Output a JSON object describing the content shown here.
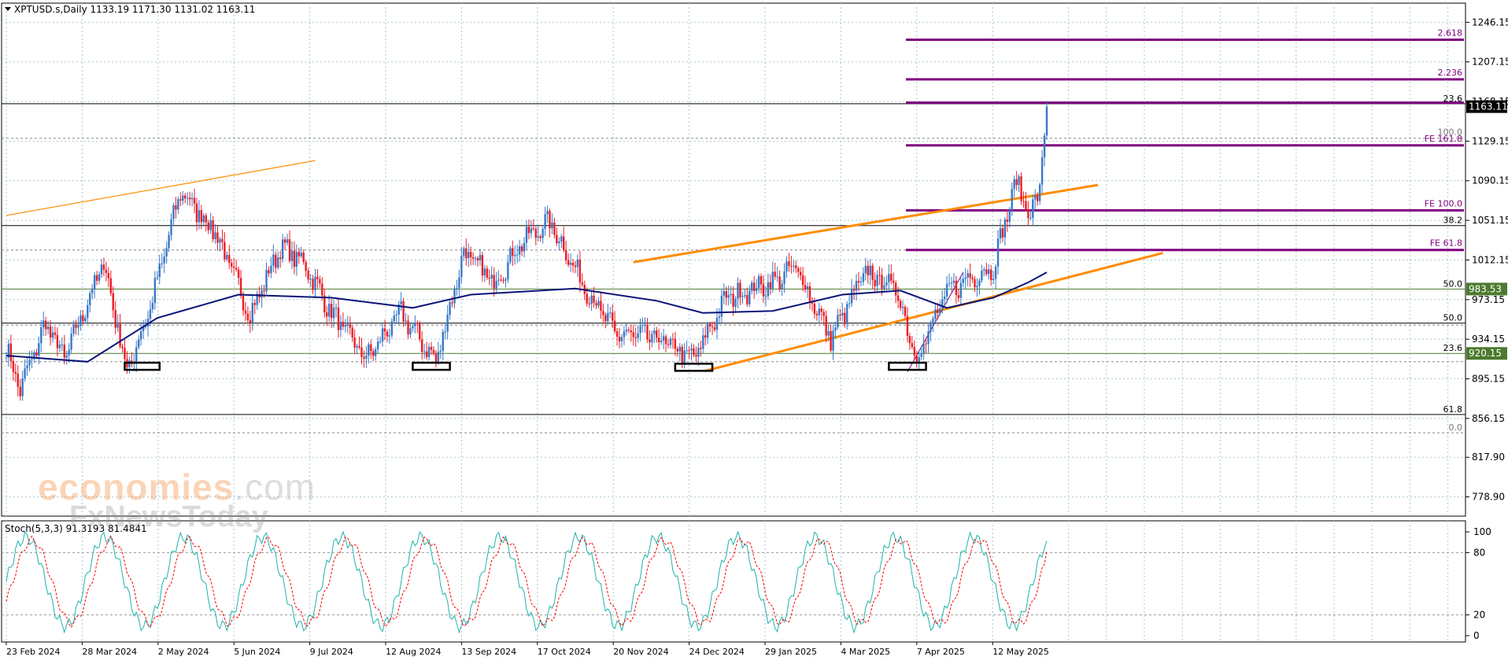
{
  "header": {
    "symbol": "XPTUSD.s,Daily",
    "ohlc": "1133.19 1171.30 1131.02 1163.11",
    "indicator": "Stoch(5,3,3) 91.3193 81.4841"
  },
  "watermark": {
    "brand": "economies",
    "tld": ".com",
    "sub": "FxNewsToday"
  },
  "colors": {
    "bull": "#3778c8",
    "bear": "#ee1c24",
    "ma": "#0a1478",
    "channel": "#ff8c00",
    "fib_ext": "#800080",
    "hline_green": "#4c7a2e",
    "grid": "#aac8d2",
    "stoch_main": "#20b2aa",
    "stoch_signal": "#ff0000"
  },
  "chart_data": [
    {
      "type": "candlestick",
      "title": "XPTUSD.s,Daily",
      "x_tick_labels": [
        "23 Feb 2024",
        "28 Mar 2024",
        "2 May 2024",
        "5 Jun 2024",
        "9 Jul 2024",
        "12 Aug 2024",
        "13 Sep 2024",
        "17 Oct 2024",
        "20 Nov 2024",
        "24 Dec 2024",
        "29 Jan 2025",
        "4 Mar 2025",
        "7 Apr 2025",
        "12 May 2025"
      ],
      "y_tick_labels": [
        "1246.15",
        "1207.15",
        "1168.15",
        "1129.15",
        "1090.15",
        "1051.15",
        "1012.15",
        "973.15",
        "934.15",
        "895.15",
        "856.15",
        "817.90",
        "778.90"
      ],
      "ylim": [
        760,
        1265
      ],
      "last_price": 1163.11,
      "price_labels": [
        {
          "text": "1163.11",
          "value": 1163.11,
          "bg": "#000000",
          "color": "#ffffff"
        },
        {
          "text": "983.53",
          "value": 983.53,
          "bg": "#4c7a2e",
          "color": "#ffffff"
        },
        {
          "text": "920.15",
          "value": 920.15,
          "bg": "#4c7a2e",
          "color": "#ffffff"
        }
      ],
      "levels": [
        {
          "label": "23.6",
          "value": 1166,
          "style": "solid",
          "color": "#000000"
        },
        {
          "label": "",
          "value": 1132,
          "style": "dotted",
          "color": "#888888"
        },
        {
          "label": "38.2",
          "value": 1046,
          "style": "solid",
          "color": "#000000"
        },
        {
          "label": "",
          "value": 1022,
          "style": "dotted",
          "color": "#888888"
        },
        {
          "label": "50.0",
          "value": 983.53,
          "style": "solid",
          "color": "#4c7a2e"
        },
        {
          "label": "50.0",
          "value": 950,
          "style": "solid",
          "color": "#000000"
        },
        {
          "label": "",
          "value": 948,
          "style": "dotted",
          "color": "#888888"
        },
        {
          "label": "23.6",
          "value": 920.15,
          "style": "solid",
          "color": "#4c7a2e"
        },
        {
          "label": "",
          "value": 912,
          "style": "dotted",
          "color": "#888888"
        },
        {
          "label": "61.8",
          "value": 860,
          "style": "solid",
          "color": "#000000"
        },
        {
          "label": "0.0",
          "value": 842,
          "style": "dotted",
          "color": "#888888"
        },
        {
          "label": "100.0",
          "value": 1133,
          "style": "none",
          "color": "#888888"
        }
      ],
      "fib_extension": {
        "start_date_index": 388,
        "lines": [
          {
            "label": "2.618",
            "value": 1229
          },
          {
            "label": "2.236",
            "value": 1190
          },
          {
            "label": "",
            "value": 1167
          },
          {
            "label": "FE 161.8",
            "value": 1125
          },
          {
            "label": "FE 100.0",
            "value": 1061
          },
          {
            "label": "FE 61.8",
            "value": 1022
          }
        ]
      },
      "trendlines": [
        {
          "name": "upper-channel",
          "x": [
            270,
            470
          ],
          "y": [
            1010,
            1086
          ],
          "width": 2
        },
        {
          "name": "lower-channel",
          "x": [
            301,
            498
          ],
          "y": [
            903,
            1019
          ],
          "width": 2
        },
        {
          "name": "old-channel",
          "x": [
            0,
            133
          ],
          "y": [
            1056,
            1110
          ],
          "width": 1
        }
      ],
      "boxes": [
        {
          "label": "low-box-1",
          "x": [
            51,
            66
          ],
          "y": [
            904,
            911
          ]
        },
        {
          "label": "low-box-2",
          "x": [
            175,
            191
          ],
          "y": [
            904,
            911
          ]
        },
        {
          "label": "low-box-3",
          "x": [
            288,
            304
          ],
          "y": [
            903,
            910
          ]
        },
        {
          "label": "low-box-4",
          "x": [
            380,
            396
          ],
          "y": [
            904,
            911
          ]
        }
      ],
      "anchors": [
        {
          "i": 0,
          "close": 925
        },
        {
          "i": 6,
          "close": 885
        },
        {
          "i": 17,
          "close": 950
        },
        {
          "i": 25,
          "close": 915
        },
        {
          "i": 42,
          "close": 1010
        },
        {
          "i": 52,
          "close": 902
        },
        {
          "i": 62,
          "close": 965
        },
        {
          "i": 75,
          "close": 1080
        },
        {
          "i": 90,
          "close": 1040
        },
        {
          "i": 105,
          "close": 958
        },
        {
          "i": 118,
          "close": 1025
        },
        {
          "i": 128,
          "close": 1010
        },
        {
          "i": 140,
          "close": 960
        },
        {
          "i": 155,
          "close": 915
        },
        {
          "i": 170,
          "close": 960
        },
        {
          "i": 185,
          "close": 912
        },
        {
          "i": 197,
          "close": 1020
        },
        {
          "i": 210,
          "close": 990
        },
        {
          "i": 222,
          "close": 1030
        },
        {
          "i": 234,
          "close": 1050
        },
        {
          "i": 248,
          "close": 990
        },
        {
          "i": 262,
          "close": 940
        },
        {
          "i": 280,
          "close": 935
        },
        {
          "i": 296,
          "close": 915
        },
        {
          "i": 310,
          "close": 975
        },
        {
          "i": 330,
          "close": 990
        },
        {
          "i": 340,
          "close": 1005
        },
        {
          "i": 355,
          "close": 935
        },
        {
          "i": 370,
          "close": 1000
        },
        {
          "i": 383,
          "close": 985
        },
        {
          "i": 392,
          "close": 915
        },
        {
          "i": 405,
          "close": 980
        },
        {
          "i": 415,
          "close": 995
        },
        {
          "i": 425,
          "close": 1005
        },
        {
          "i": 430,
          "close": 1050
        },
        {
          "i": 435,
          "close": 1090
        },
        {
          "i": 441,
          "close": 1055
        },
        {
          "i": 445,
          "close": 1085
        },
        {
          "i": 448,
          "close": 1163.11
        }
      ],
      "ma_series": [
        {
          "i": 0,
          "v": 918
        },
        {
          "i": 35,
          "v": 912
        },
        {
          "i": 65,
          "v": 955
        },
        {
          "i": 100,
          "v": 978
        },
        {
          "i": 140,
          "v": 975
        },
        {
          "i": 175,
          "v": 965
        },
        {
          "i": 200,
          "v": 978
        },
        {
          "i": 245,
          "v": 984
        },
        {
          "i": 280,
          "v": 972
        },
        {
          "i": 300,
          "v": 960
        },
        {
          "i": 330,
          "v": 962
        },
        {
          "i": 360,
          "v": 978
        },
        {
          "i": 385,
          "v": 982
        },
        {
          "i": 405,
          "v": 965
        },
        {
          "i": 425,
          "v": 975
        },
        {
          "i": 440,
          "v": 990
        },
        {
          "i": 448,
          "v": 1000
        }
      ]
    },
    {
      "type": "line",
      "title": "Stoch(5,3,3)",
      "ylim": [
        0,
        100
      ],
      "y_tick_labels": [
        "100",
        "80",
        "20",
        "0"
      ],
      "levels": [
        80,
        20
      ],
      "series": [
        {
          "name": "Stoch(5,3,3) 91.3193",
          "color": "#20b2aa",
          "period": 34,
          "amp": 43,
          "mid": 52,
          "last": 91.32
        },
        {
          "name": "81.4841",
          "color": "#ff0000",
          "period": 34,
          "amp": 40,
          "mid": 52,
          "last": 81.48
        }
      ]
    }
  ]
}
